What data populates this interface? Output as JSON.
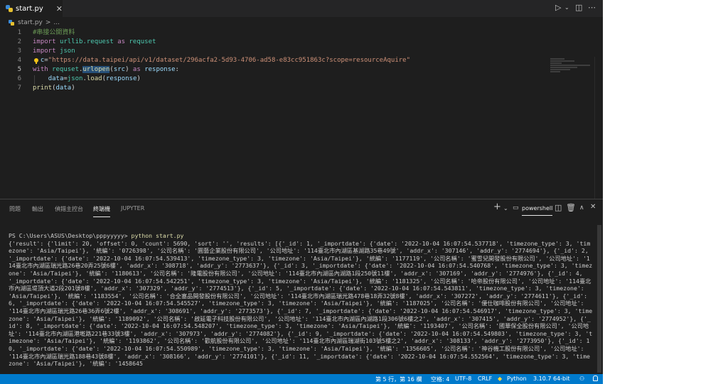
{
  "tab": {
    "filename": "start.py"
  },
  "toolbar": {
    "run_icon": "play-icon",
    "split_icon": "split-editor-icon",
    "more_icon": "ellipsis-icon"
  },
  "breadcrumb": {
    "file": "start.py",
    "separator": ">",
    "tail": "..."
  },
  "editor": {
    "lines": [
      {
        "num": "1",
        "tokens": [
          {
            "t": "#串接公開資料",
            "c": "com"
          }
        ]
      },
      {
        "num": "2",
        "tokens": [
          {
            "t": "import ",
            "c": "kw"
          },
          {
            "t": "urllib.request",
            "c": "cls"
          },
          {
            "t": " as ",
            "c": "kw"
          },
          {
            "t": "requset",
            "c": "cls"
          }
        ]
      },
      {
        "num": "3",
        "tokens": [
          {
            "t": "import ",
            "c": "kw"
          },
          {
            "t": "json",
            "c": "cls"
          }
        ]
      },
      {
        "num": "4",
        "tokens": [
          {
            "t": "  ",
            "c": "def"
          },
          {
            "t": "c",
            "c": "var"
          },
          {
            "t": "=",
            "c": "def"
          },
          {
            "t": "\"https://data.taipei/api/v1/dataset/296acfa2-5d93-4706-ad58-e83cc951863c?scope=resourceAquire\"",
            "c": "str"
          }
        ]
      },
      {
        "num": "5",
        "tokens": [
          {
            "t": "with ",
            "c": "kw"
          },
          {
            "t": "requset",
            "c": "cls"
          },
          {
            "t": ".",
            "c": "def"
          },
          {
            "t": "urlopen",
            "c": "fn",
            "hl": true
          },
          {
            "t": "(",
            "c": "def"
          },
          {
            "t": "src",
            "c": "var"
          },
          {
            "t": ") ",
            "c": "def"
          },
          {
            "t": "as ",
            "c": "kw"
          },
          {
            "t": "response",
            "c": "var"
          },
          {
            "t": ":",
            "c": "def"
          }
        ]
      },
      {
        "num": "6",
        "tokens": [
          {
            "t": "    ",
            "c": "def"
          },
          {
            "t": "data",
            "c": "var"
          },
          {
            "t": "=",
            "c": "def"
          },
          {
            "t": "json",
            "c": "cls"
          },
          {
            "t": ".",
            "c": "def"
          },
          {
            "t": "load",
            "c": "fn"
          },
          {
            "t": "(",
            "c": "def"
          },
          {
            "t": "response",
            "c": "var"
          },
          {
            "t": ")",
            "c": "def"
          }
        ]
      },
      {
        "num": "7",
        "tokens": [
          {
            "t": "print",
            "c": "fn"
          },
          {
            "t": "(",
            "c": "def"
          },
          {
            "t": "data",
            "c": "var"
          },
          {
            "t": ")",
            "c": "def"
          }
        ]
      }
    ]
  },
  "panel": {
    "tabs": [
      {
        "label": "問題"
      },
      {
        "label": "輸出"
      },
      {
        "label": "偵錯主控台"
      },
      {
        "label": "終端機"
      },
      {
        "label": "JUPYTER"
      }
    ],
    "terminal_name": "powershell",
    "prompt": "PS C:\\Users\\ASUS\\Desktop\\pppyyyyy> ",
    "command": "python start.py",
    "output": "{'result': {'limit': 20, 'offset': 0, 'count': 5690, 'sort': '', 'results': [{'_id': 1, '_importdate': {'date': '2022-10-04 16:07:54.537718', 'timezone_type': 3, 'timezone': 'Asia/Taipei'}, '統編': '0726398', '公司名稱': '圓藝企業股份有限公司', '公司地址': '114臺北市內湖區基湖路35巷49號', 'addr_x': '307146', 'addr_y': '2774694'}, {'_id': 2, '_importdate': {'date': '2022-10-04 16:07:54.539413', 'timezone_type': 3, 'timezone': 'Asia/Taipei'}, '統編': '1177119', '公司名稱': '蜜雪兒開發股份有限公司', '公司地址': '114臺北市內湖區瑞光路26巷20弄25號6樓', 'addr_x': '308718', 'addr_y': '2773637'}, {'_id': 3, '_importdate': {'date': '2022-10-04 16:07:54.540768', 'timezone_type': 3, 'timezone': 'Asia/Taipei'}, '統編': '1180613', '公司名稱': '隆電股份有限公司', '公司地址': '114臺北市內湖區內湖路1段250號11樓', 'addr_x': '307169', 'addr_y': '2774976'}, {'_id': 4, '_importdate': {'date': '2022-10-04 16:07:54.542251', 'timezone_type': 3, 'timezone': 'Asia/Taipei'}, '統編': '1181325', '公司名稱': '哈帝股份有限公司', '公司地址': '114臺北市內湖區堤頂大道2段201號8樓', 'addr_x': '307329', 'addr_y': '2774513'}, {'_id': 5, '_importdate': {'date': '2022-10-04 16:07:54.543811', 'timezone_type': 3, 'timezone': 'Asia/Taipei'}, '統編': '1183554', '公司名稱': '合全塞品開發股份有限公司', '公司地址': '114臺北市內湖區瑞光路478巷18弄32號8樓', 'addr_x': '307272', 'addr_y': '2774611'}, {'_id': 6, '_importdate': {'date': '2022-10-04 16:07:54.545527', 'timezone_type': 3, 'timezone': 'Asia/Taipei'}, '統編': '1187025', '公司名稱': '優仕咖啡股份有限公司', '公司地址': '114臺北市內湖區瑞光路26巷36弄6號2樓', 'addr_x': '308691', 'addr_y': '2773573'}, {'_id': 7, '_importdate': {'date': '2022-10-04 16:07:54.546917', 'timezone_type': 3, 'timezone': 'Asia/Taipei'}, '統編': '1189092', '公司名稱': '啟延電子科技股份有限公司', '公司地址': '114臺北市內湖區內湖路1段306號6樓之2', 'addr_x': '307415', 'addr_y': '2774952'}, {'_id': 8, '_importdate': {'date': '2022-10-04 16:07:54.548207', 'timezone_type': 3, 'timezone': 'Asia/Taipei'}, '統編': '1193407', '公司名稱': '國華保全股份有限公司', '公司地址': '114臺北市內湖區港墘路221巷33號3樓', 'addr_x': '307973', 'addr_y': '2774082'}, {'_id': 9, '_importdate': {'date': '2022-10-04 16:07:54.549803', 'timezone_type': 3, 'timezone': 'Asia/Taipei'}, '統編': '1193862', '公司名稱': '歡航股份有限公司', '公司地址': '114臺北市內湖區瑞湖街103號5樓之2', 'addr_x': '308133', 'addr_y': '2773950'}, {'_id': 10, '_importdate': {'date': '2022-10-04 16:07:54.550989', 'timezone_type': 3, 'timezone': 'Asia/Taipei'}, '統編': '1356605', '公司名稱': '神谷機工股份有限公司', '公司地址': '114臺北市內湖區瑞光路188巷43號8樓', 'addr_x': '308166', 'addr_y': '2774101'}, {'_id': 11, '_importdate': {'date': '2022-10-04 16:07:54.552564', 'timezone_type': 3, 'timezone': 'Asia/Taipei'}, '統編': '1458645"
  },
  "status": {
    "position": "第 5 行，第 16 欄",
    "spaces": "空格: 4",
    "encoding": "UTF-8",
    "eol": "CRLF",
    "language": "Python",
    "interpreter": "3.10.7 64-bit"
  },
  "colors": {
    "status_bar": "#007acc",
    "editor_bg": "#1e1e1e",
    "string": "#ce9178",
    "keyword": "#c586c0"
  }
}
